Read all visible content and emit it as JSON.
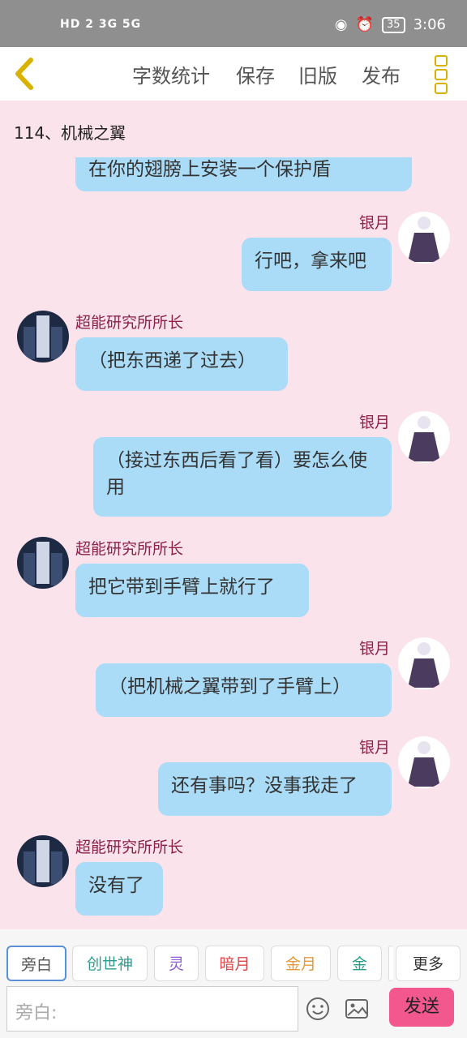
{
  "status_bar": {
    "network_left": "HD 2  3G  5G",
    "battery": "35",
    "time": "3:06"
  },
  "toolbar": {
    "word_count": "字数统计",
    "save": "保存",
    "old_version": "旧版",
    "publish": "发布"
  },
  "chapter_title": "114、机械之翼",
  "messages": [
    {
      "side": "left",
      "speaker": "",
      "text": "在你的翅膀上安装一个保护盾"
    },
    {
      "side": "right",
      "speaker": "银月",
      "text": "行吧，拿来吧"
    },
    {
      "side": "left",
      "speaker": "超能研究所所长",
      "text": "（把东西递了过去）"
    },
    {
      "side": "right",
      "speaker": "银月",
      "text": "（接过东西后看了看）要怎么使用"
    },
    {
      "side": "left",
      "speaker": "超能研究所所长",
      "text": "把它带到手臂上就行了"
    },
    {
      "side": "right",
      "speaker": "银月",
      "text": "（把机械之翼带到了手臂上）"
    },
    {
      "side": "right",
      "speaker": "银月",
      "text": "还有事吗？没事我走了"
    },
    {
      "side": "left",
      "speaker": "超能研究所所长",
      "text": "没有了"
    }
  ],
  "role_tabs": [
    {
      "label": "旁白",
      "color": "#555555"
    },
    {
      "label": "创世神",
      "color": "#2a9d8f"
    },
    {
      "label": "灵",
      "color": "#8e5bd6"
    },
    {
      "label": "暗月",
      "color": "#d94b4b"
    },
    {
      "label": "金月",
      "color": "#e39a3a"
    },
    {
      "label": "金",
      "color": "#2a9d8f"
    },
    {
      "label": "更多",
      "color": "#333333"
    }
  ],
  "input": {
    "placeholder": "旁白:"
  },
  "send_label": "发送"
}
